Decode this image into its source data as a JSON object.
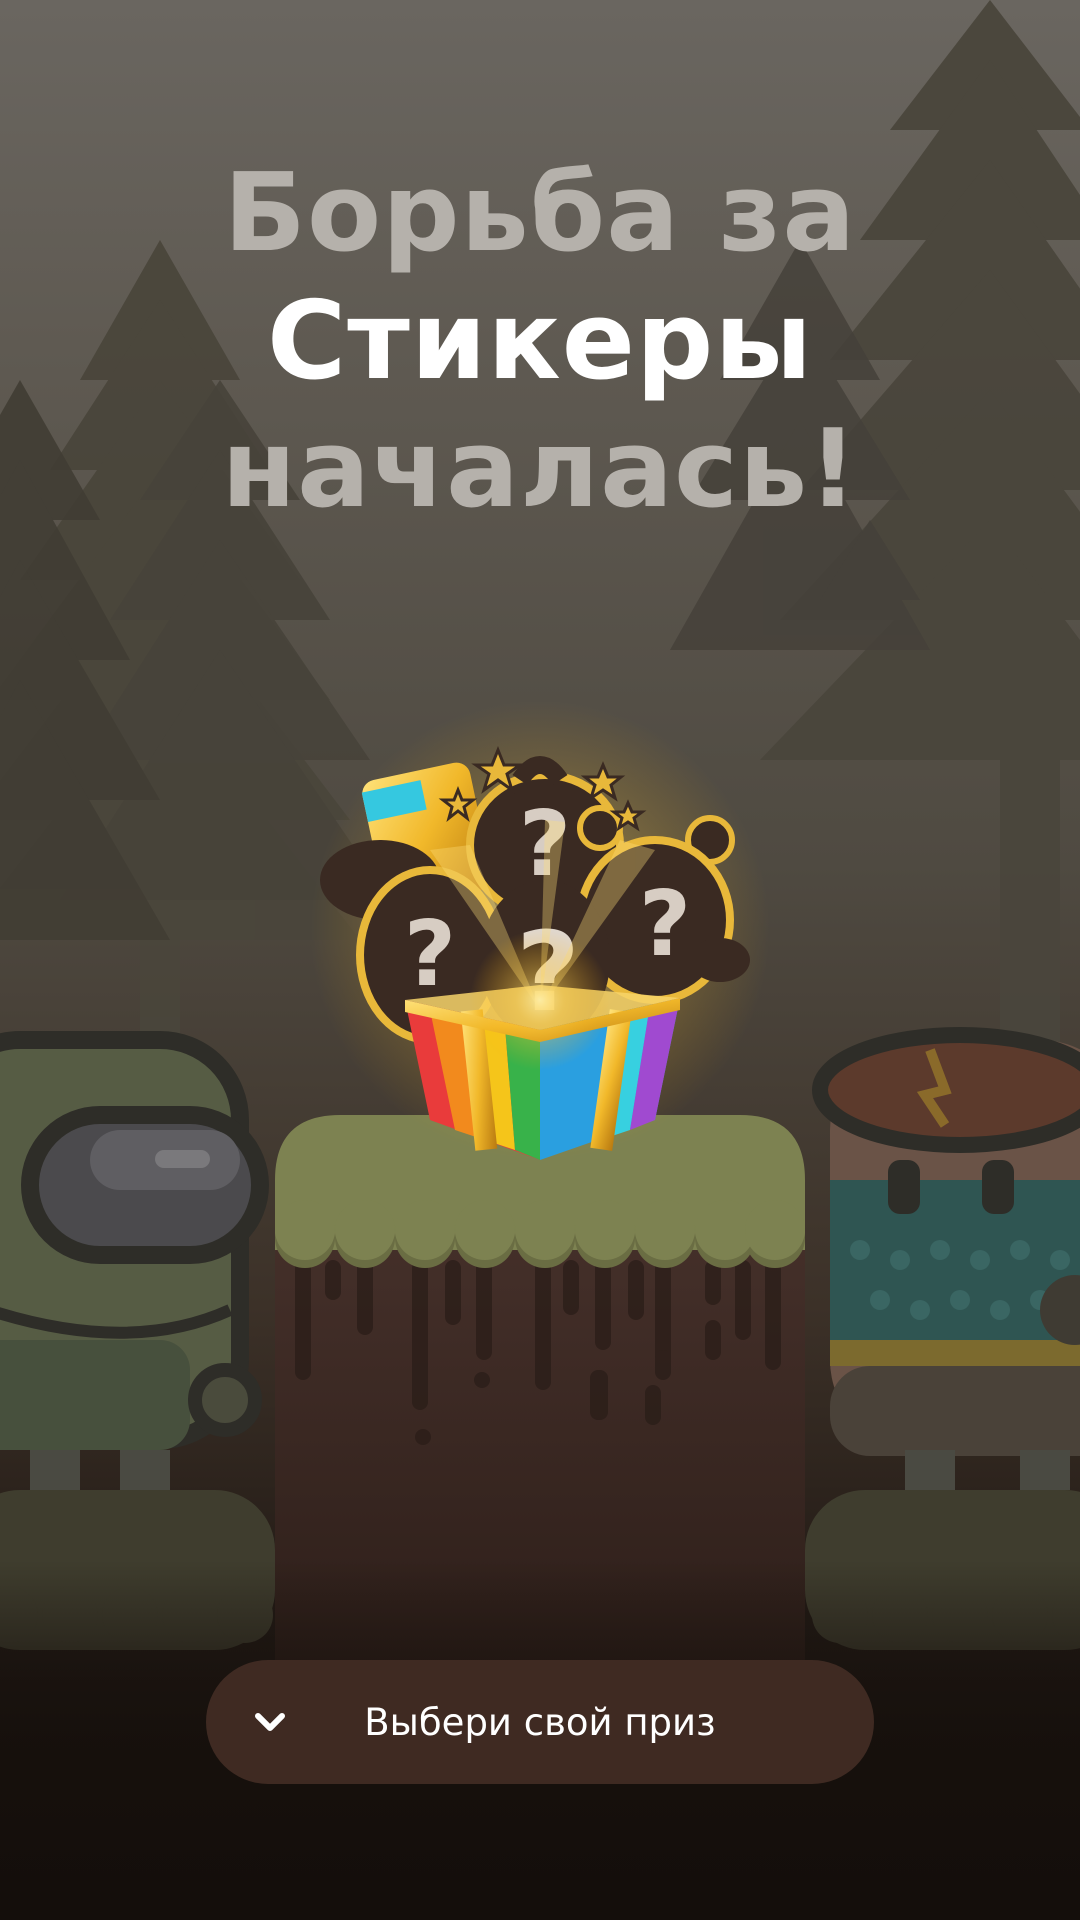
{
  "headline": {
    "line1": "Борьба за",
    "line2": "Стикеры",
    "line3": "началась!"
  },
  "prize": {
    "question_mark": "?"
  },
  "cta": {
    "label": "Выбери свой приз",
    "icon": "chevron-down-icon"
  },
  "colors": {
    "headline_muted": "#b5b1ab",
    "headline_bright": "#ffffff",
    "button_bg": "#3f2a22",
    "grass": "#7d8251",
    "dirt": "#3f2a22"
  }
}
